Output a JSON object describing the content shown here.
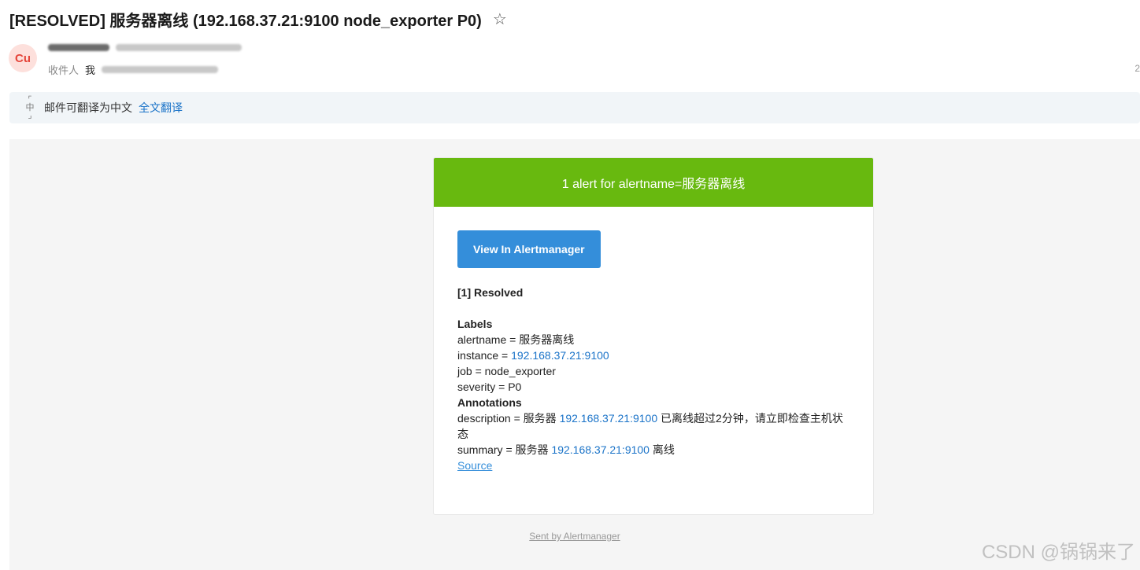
{
  "email": {
    "subject": "[RESOLVED] 服务器离线 (192.168.37.21:9100 node_exporter P0)",
    "star_icon": "☆",
    "avatar_text": "Cu",
    "recipient_label": "收件人",
    "recipient_me": "我"
  },
  "translate": {
    "icon": "translate-icon",
    "text": "邮件可翻译为中文",
    "link": "全文翻译"
  },
  "alert": {
    "header": "1 alert for alertname=服务器离线",
    "button_label": "View In Alertmanager",
    "status": "[1] Resolved",
    "labels_title": "Labels",
    "labels": {
      "alertname_key": "alertname = ",
      "alertname_val": "服务器离线",
      "instance_key": "instance = ",
      "instance_val": "192.168.37.21:9100",
      "job": "job = node_exporter",
      "severity": "severity = P0"
    },
    "annotations_title": "Annotations",
    "annotations": {
      "desc_prefix": "description = 服务器 ",
      "desc_ip": "192.168.37.21:9100",
      "desc_suffix": " 已离线超过2分钟，请立即检查主机状态",
      "summary_prefix": "summary = 服务器 ",
      "summary_ip": "192.168.37.21:9100",
      "summary_suffix": " 离线"
    },
    "source_link": "Source"
  },
  "footer": "Sent by Alertmanager",
  "watermark": "CSDN @锅锅来了",
  "colors": {
    "header_green": "#68b90f",
    "button_blue": "#348eda",
    "link_blue": "#1a73c8",
    "avatar_bg": "#fde0dc",
    "avatar_fg": "#e5453a"
  }
}
